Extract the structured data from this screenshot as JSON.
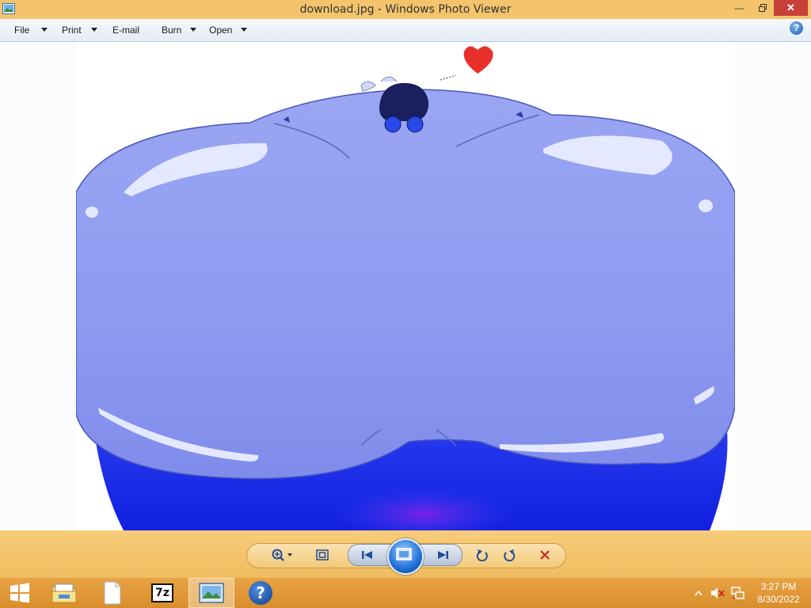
{
  "window": {
    "title": "download.jpg - Windows Photo Viewer",
    "icon": "photo-viewer-icon",
    "controls": [
      "minimize-icon",
      "restore-icon",
      "close-icon"
    ]
  },
  "menu": {
    "items": [
      {
        "label": "File",
        "has_dropdown": true
      },
      {
        "label": "Print",
        "has_dropdown": true
      },
      {
        "label": "E-mail",
        "has_dropdown": false
      },
      {
        "label": "Burn",
        "has_dropdown": true
      },
      {
        "label": "Open",
        "has_dropdown": true
      }
    ],
    "help_label": "?"
  },
  "image": {
    "filename": "download.jpg",
    "description_colors": {
      "blob_light": "#8d9bf0",
      "blob_dark": "#1b2bf2",
      "heart": "#e8302a",
      "hair": "#1a1f5e"
    }
  },
  "controls": {
    "icons": [
      "zoom-icon",
      "actual-size-icon",
      "previous-icon",
      "slideshow-icon",
      "next-icon",
      "rotate-counterclockwise-icon",
      "rotate-clockwise-icon",
      "delete-icon"
    ]
  },
  "taskbar": {
    "apps": [
      "start-icon",
      "file-explorer-icon",
      "document-icon",
      "7zip-icon",
      "photo-viewer-icon",
      "help-icon"
    ],
    "active_app": "photo-viewer-icon",
    "app_label_7z": "7z",
    "app_label_help": "?",
    "tray_icons": [
      "show-hidden-icons",
      "volume-muted-icon",
      "network-icon"
    ],
    "clock": {
      "time": "3:27 PM",
      "date": "8/30/2022"
    }
  },
  "colors": {
    "titlebar": "#f3c46c",
    "taskbar": "#e09a38",
    "close": "#c7403a",
    "accent_blue": "#1f6fd6"
  }
}
